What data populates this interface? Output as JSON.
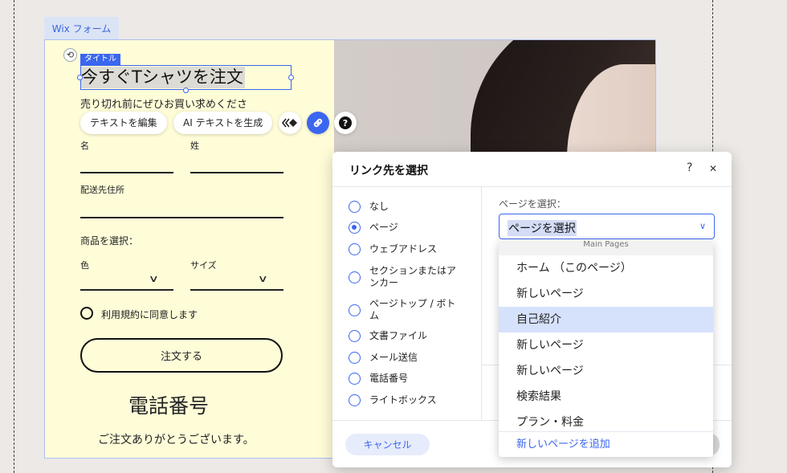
{
  "colors": {
    "accent": "#3b66f0",
    "form_bg": "#fffdd8",
    "canvas_bg": "#ece9e6"
  },
  "editor": {
    "form_tag": "Wix フォーム",
    "title_tag": "タイトル",
    "title_text": "今すぐTシャツを注文",
    "subtitle": "売り切れ前にぜひお買い求めくださ",
    "toolbar": {
      "edit_text": "テキストを編集",
      "ai_text": "AI テキストを生成",
      "animation_icon": "diamond-arrows-icon",
      "link_icon": "link-icon",
      "help_icon": "question-icon"
    }
  },
  "form": {
    "first_name_label": "名",
    "last_name_label": "姓",
    "address_label": "配送先住所",
    "product_label": "商品を選択：",
    "color_label": "色",
    "size_label": "サイズ",
    "terms_label": "利用規約に同意します",
    "order_button": "注文する",
    "phone_heading": "電話番号",
    "thanks": "ご注文ありがとうございます。"
  },
  "dialog": {
    "title": "リンク先を選択",
    "help": "?",
    "close": "✕",
    "options": [
      {
        "label": "なし",
        "checked": false
      },
      {
        "label": "ページ",
        "checked": true
      },
      {
        "label": "ウェブアドレス",
        "checked": false
      },
      {
        "label": "セクションまたはアンカー",
        "checked": false
      },
      {
        "label": "ページトップ / ボトム",
        "checked": false
      },
      {
        "label": "文書ファイル",
        "checked": false
      },
      {
        "label": "メール送信",
        "checked": false
      },
      {
        "label": "電話番号",
        "checked": false
      },
      {
        "label": "ライトボックス",
        "checked": false
      }
    ],
    "page_select_label": "ページを選択：",
    "page_select_value": "ページを選択",
    "cancel": "キャンセル"
  },
  "dropdown": {
    "group": "Main Pages",
    "items": [
      {
        "label": "ホーム （このページ）",
        "selected": false
      },
      {
        "label": "新しいページ",
        "selected": false
      },
      {
        "label": "自己紹介",
        "selected": true
      },
      {
        "label": "新しいページ",
        "selected": false
      },
      {
        "label": "新しいページ",
        "selected": false
      },
      {
        "label": "検索結果",
        "selected": false
      },
      {
        "label": "プラン・料金",
        "selected": false
      }
    ],
    "add_page": "新しいページを追加"
  }
}
